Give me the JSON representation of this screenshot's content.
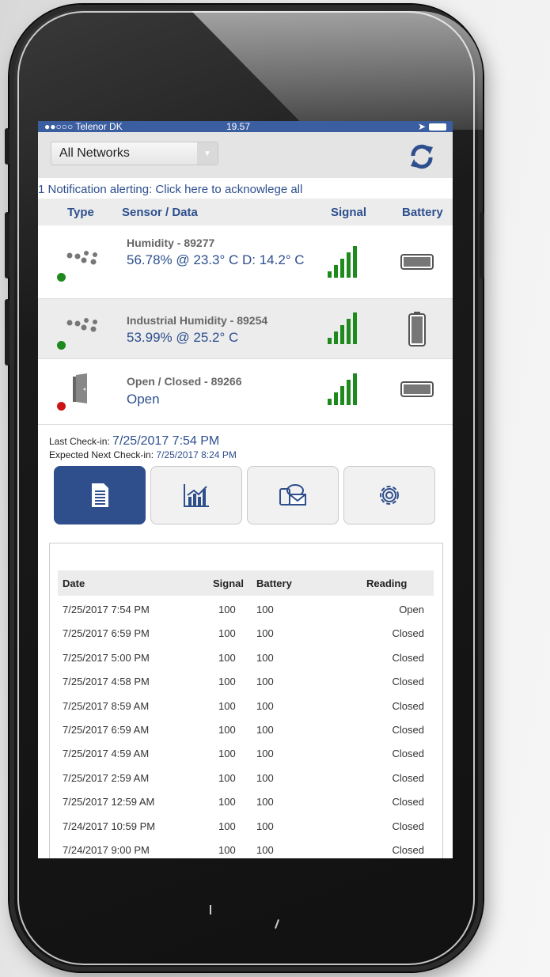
{
  "status_bar": {
    "carrier": "●●○○○ Telenor DK",
    "time": "19.57"
  },
  "network_select": {
    "value": "All Networks"
  },
  "notification": "1 Notification alerting: Click here to acknowlege all",
  "columns": {
    "type": "Type",
    "sensor": "Sensor / Data",
    "signal": "Signal",
    "battery": "Battery"
  },
  "sensors": [
    {
      "name": "Humidity - 89277",
      "data": "56.78% @ 23.3° C D: 14.2° C",
      "status_color": "#1e8a1e",
      "type_icon": "humidity-icon",
      "battery": "horizontal-battery-icon"
    },
    {
      "name": "Industrial Humidity - 89254",
      "data": "53.99% @ 25.2° C",
      "status_color": "#1e8a1e",
      "type_icon": "humidity-icon",
      "battery": "vertical-battery-icon"
    },
    {
      "name": "Open / Closed - 89266",
      "data": "Open",
      "status_color": "#cc1414",
      "type_icon": "door-icon",
      "battery": "horizontal-battery-icon"
    }
  ],
  "checkin": {
    "last_label": "Last Check-in:",
    "last_value": "7/25/2017 7:54 PM",
    "next_label": "Expected Next Check-in:",
    "next_value": "7/25/2017 8:24 PM"
  },
  "tabs": [
    {
      "name": "history",
      "icon": "document-icon"
    },
    {
      "name": "chart",
      "icon": "chart-icon"
    },
    {
      "name": "notifications",
      "icon": "message-icon"
    },
    {
      "name": "settings",
      "icon": "gear-icon"
    }
  ],
  "history": {
    "headers": {
      "date": "Date",
      "signal": "Signal",
      "battery": "Battery",
      "reading": "Reading"
    },
    "rows": [
      {
        "date": "7/25/2017 7:54 PM",
        "signal": "100",
        "battery": "100",
        "reading": "Open"
      },
      {
        "date": "7/25/2017 6:59 PM",
        "signal": "100",
        "battery": "100",
        "reading": "Closed"
      },
      {
        "date": "7/25/2017 5:00 PM",
        "signal": "100",
        "battery": "100",
        "reading": "Closed"
      },
      {
        "date": "7/25/2017 4:58 PM",
        "signal": "100",
        "battery": "100",
        "reading": "Closed"
      },
      {
        "date": "7/25/2017 8:59 AM",
        "signal": "100",
        "battery": "100",
        "reading": "Closed"
      },
      {
        "date": "7/25/2017 6:59 AM",
        "signal": "100",
        "battery": "100",
        "reading": "Closed"
      },
      {
        "date": "7/25/2017 4:59 AM",
        "signal": "100",
        "battery": "100",
        "reading": "Closed"
      },
      {
        "date": "7/25/2017 2:59 AM",
        "signal": "100",
        "battery": "100",
        "reading": "Closed"
      },
      {
        "date": "7/25/2017 12:59 AM",
        "signal": "100",
        "battery": "100",
        "reading": "Closed"
      },
      {
        "date": "7/24/2017 10:59 PM",
        "signal": "100",
        "battery": "100",
        "reading": "Closed"
      },
      {
        "date": "7/24/2017 9:00 PM",
        "signal": "100",
        "battery": "100",
        "reading": "Closed"
      }
    ]
  },
  "colors": {
    "accent": "#2d4f8e",
    "signal_green": "#1e8a1e"
  }
}
